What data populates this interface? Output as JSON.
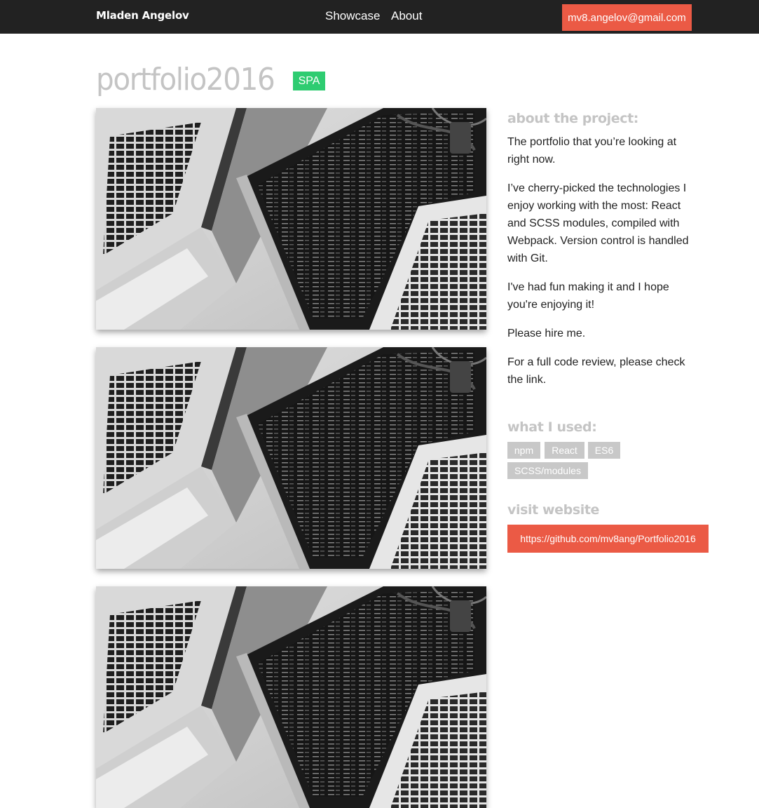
{
  "header": {
    "brand": "Mladen Angelov",
    "nav": [
      "Showcase",
      "About"
    ],
    "email": "mv8.angelov@gmail.com"
  },
  "project": {
    "title": "portfolio2016",
    "badge": "SPA",
    "images": [
      {
        "icon": "laptops-photo"
      },
      {
        "icon": "laptops-photo"
      },
      {
        "icon": "laptops-photo"
      }
    ]
  },
  "about": {
    "heading": "about the project:",
    "paragraphs": [
      "The portfolio that you’re looking at right now.",
      "I’ve cherry-picked the technologies I enjoy working with the most: React and SCSS modules, compiled with Webpack. Version control is handled with Git.",
      "I've had fun making it and I hope you're enjoying it!",
      "Please hire me.",
      "For a full code review, please check the link."
    ]
  },
  "used": {
    "heading": "what I used:",
    "tags": [
      "npm",
      "React",
      "ES6",
      "SCSS/modules"
    ]
  },
  "visit": {
    "heading": "visit website",
    "link": "https://github.com/mv8ang/Portfolio2016"
  },
  "colors": {
    "navbar": "#222222",
    "accent": "#eb5a45",
    "badge": "#2ecc71",
    "muted": "#c4c4c4",
    "tag": "#c8c8c8"
  }
}
